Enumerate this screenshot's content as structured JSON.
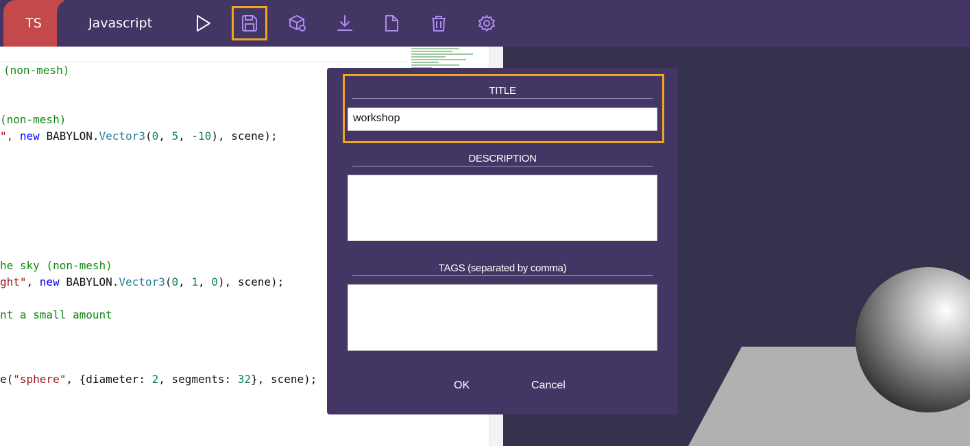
{
  "tabs": {
    "ts_label": "TS",
    "js_label": "Javascript"
  },
  "toolbar": {
    "run_icon": "play-icon",
    "save_icon": "save-icon",
    "download_icon": "download-icon",
    "new_icon": "new-file-icon",
    "clear_icon": "trash-icon",
    "settings_icon": "gear-icon"
  },
  "colors": {
    "topbar": "#433564",
    "ts_tab": "#c4494a",
    "highlight": "#f3a51c",
    "viewport": "#34324c",
    "modal": "#433564"
  },
  "code": {
    "line1": "(non-mesh)",
    "line2": "(non-mesh)",
    "line3_a": "\", ",
    "line3_new": "new",
    "line3_b": " BABYLON.",
    "line3_type": "Vector3",
    "line3_c": "(",
    "line3_n1": "0",
    "line3_d": ", ",
    "line3_n2": "5",
    "line3_e": ", ",
    "line3_n3": "-10",
    "line3_f": "), scene);",
    "line4": "he sky (non-mesh)",
    "line5_a": "ght\"",
    "line5_b": ", ",
    "line5_new": "new",
    "line5_c": " BABYLON.",
    "line5_type": "Vector3",
    "line5_d": "(",
    "line5_n1": "0",
    "line5_e": ", ",
    "line5_n2": "1",
    "line5_f": ", ",
    "line5_n3": "0",
    "line5_g": "), scene);",
    "line6": "nt a small amount",
    "line7_a": "e(",
    "line7_str": "\"sphere\"",
    "line7_b": ", {diameter: ",
    "line7_n1": "2",
    "line7_c": ", segments: ",
    "line7_n2": "32",
    "line7_d": "}, scene);"
  },
  "modal": {
    "title_label": "TITLE",
    "title_value": "workshop",
    "description_label": "DESCRIPTION",
    "description_value": "",
    "tags_label": "TAGS (separated by comma)",
    "tags_value": "",
    "ok_label": "OK",
    "cancel_label": "Cancel"
  }
}
